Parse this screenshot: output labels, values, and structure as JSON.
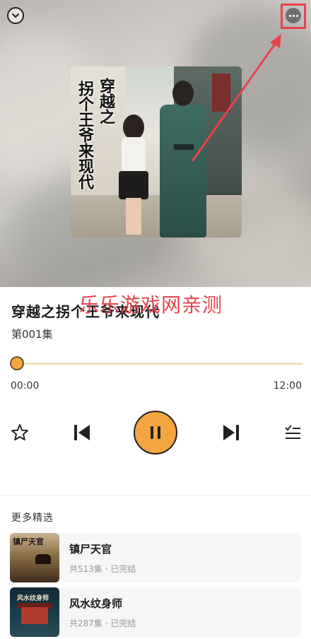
{
  "cover": {
    "title_line1": "穿越之",
    "title_line2": "拐个王爷来现代"
  },
  "track": {
    "title": "穿越之拐个王爷来现代",
    "episode": "第001集"
  },
  "watermark": "乐乐游戏网亲测",
  "progress": {
    "current_time": "00:00",
    "total_time": "12:00",
    "fraction": 0
  },
  "player": {
    "state": "playing"
  },
  "section": {
    "title": "更多精选"
  },
  "recommendations": [
    {
      "name": "镇尸天官",
      "meta": "共513集 · 已完结",
      "thumb_text": "镇尸天官"
    },
    {
      "name": "风水纹身师",
      "meta": "共287集 · 已完结",
      "thumb_text": "风水纹身师"
    }
  ],
  "colors": {
    "accent": "#f2a541",
    "annotation": "#e8434c",
    "progress_track": "#f3dfbf"
  }
}
